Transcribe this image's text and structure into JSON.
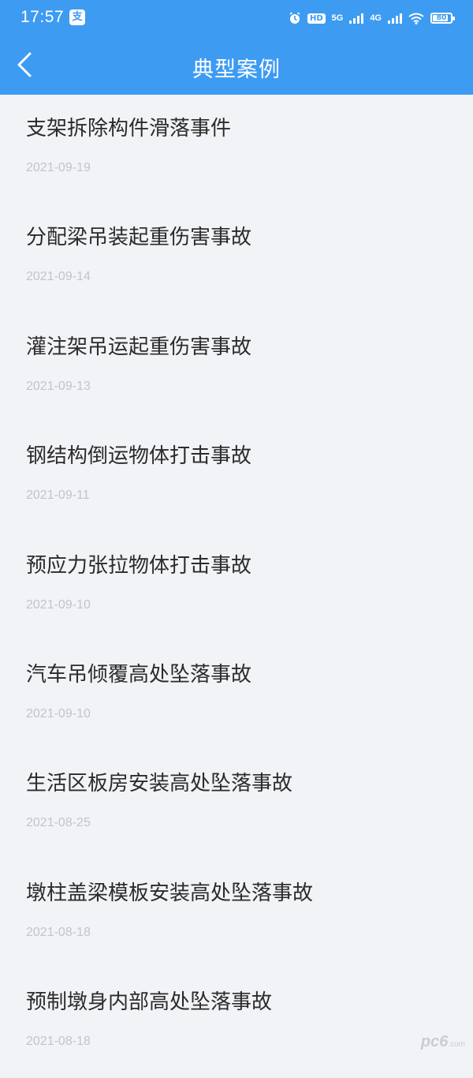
{
  "status_bar": {
    "time": "17:57",
    "app_icon_glyph": "支",
    "hd_label": "HD",
    "network_5g": "5G",
    "network_4g": "4G",
    "battery_level": "80"
  },
  "nav": {
    "title": "典型案例",
    "back_icon": "chevron-left-icon"
  },
  "cases": [
    {
      "title": "支架拆除构件滑落事件",
      "date": "2021-09-19"
    },
    {
      "title": "分配梁吊装起重伤害事故",
      "date": "2021-09-14"
    },
    {
      "title": "灌注架吊运起重伤害事故",
      "date": "2021-09-13"
    },
    {
      "title": "钢结构倒运物体打击事故",
      "date": "2021-09-11"
    },
    {
      "title": "预应力张拉物体打击事故",
      "date": "2021-09-10"
    },
    {
      "title": "汽车吊倾覆高处坠落事故",
      "date": "2021-09-10"
    },
    {
      "title": "生活区板房安装高处坠落事故",
      "date": "2021-08-25"
    },
    {
      "title": "墩柱盖梁模板安装高处坠落事故",
      "date": "2021-08-18"
    },
    {
      "title": "预制墩身内部高处坠落事故",
      "date": "2021-08-18"
    }
  ],
  "watermark": {
    "text": "pc6",
    "suffix": ".com"
  },
  "colors": {
    "header": "#3d9bf2",
    "background": "#f2f3f6",
    "title_text": "#2b2b2b",
    "date_text": "#c2c4c8"
  }
}
